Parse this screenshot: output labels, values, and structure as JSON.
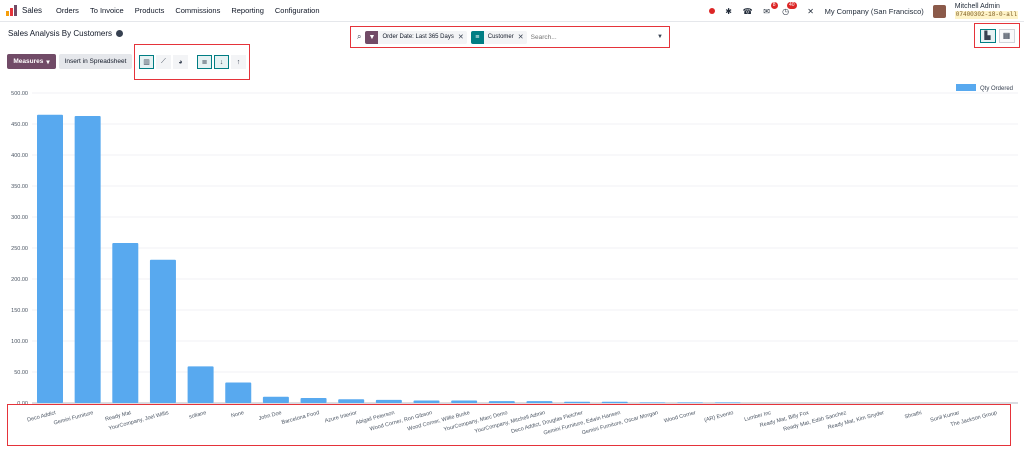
{
  "app": {
    "name": "Sales",
    "brand_color": "#e5333a"
  },
  "menu": [
    "Orders",
    "To Invoice",
    "Products",
    "Commissions",
    "Reporting",
    "Configuration"
  ],
  "systray": {
    "chat_badge": "8",
    "activity_badge": "40",
    "company": "My Company (San Francisco)",
    "user_name": "Mitchell Admin",
    "db_name": "07400302-18-0-all"
  },
  "breadcrumb": {
    "title": "Sales Analysis By Customers"
  },
  "search": {
    "facets": [
      {
        "label": "Order Date: Last 365 Days",
        "icon": "filter-icon",
        "color": "#714b67"
      },
      {
        "label": "Customer",
        "icon": "group-by-icon",
        "color": "#017e84"
      }
    ],
    "placeholder": "Search..."
  },
  "toolbar": {
    "measures_label": "Measures",
    "insert_label": "Insert in Spreadsheet"
  },
  "chart_data": {
    "type": "bar",
    "legend": [
      "Qty Ordered"
    ],
    "legend_position": "top-right",
    "series": [
      {
        "name": "Qty Ordered",
        "color": "#58a9ef",
        "values": [
          465,
          463,
          258,
          231,
          59,
          33,
          10,
          8,
          6,
          5,
          4,
          4,
          3,
          3,
          2,
          2,
          1,
          1,
          1,
          0,
          0,
          0,
          0,
          0,
          0,
          0,
          0
        ]
      }
    ],
    "categories": [
      "Deco Addict",
      "Gemini Furniture",
      "Ready Mat",
      "YourCompany, Joel Willis",
      "sofiane",
      "None",
      "John Doe",
      "Barcelona Food",
      "Azure Interior",
      "Abigail Peterson",
      "Wood Corner, Ron Gibson",
      "Wood Corner, Willie Burke",
      "YourCompany, Marc Demo",
      "YourCompany, Mitchell Admin",
      "Deco Addict, Douglas Fletcher",
      "Gemini Furniture, Edwin Hansen",
      "Gemini Furniture, Oscar Morgan",
      "Wood Corner",
      "(AR) Evento",
      "Lumber Inc",
      "Ready Mat, Billy Fox",
      "Ready Mat, Edith Sanchez",
      "Ready Mat, Kim Snyder",
      "Shrathi",
      "Sunil Kumar",
      "The Jackson Group"
    ],
    "ylim": [
      0,
      500
    ],
    "yticks": [
      "500.00",
      "450.00",
      "400.00",
      "350.00",
      "300.00",
      "250.00",
      "200.00",
      "150.00",
      "100.00",
      "50.00",
      "0.00"
    ],
    "grid": true
  }
}
